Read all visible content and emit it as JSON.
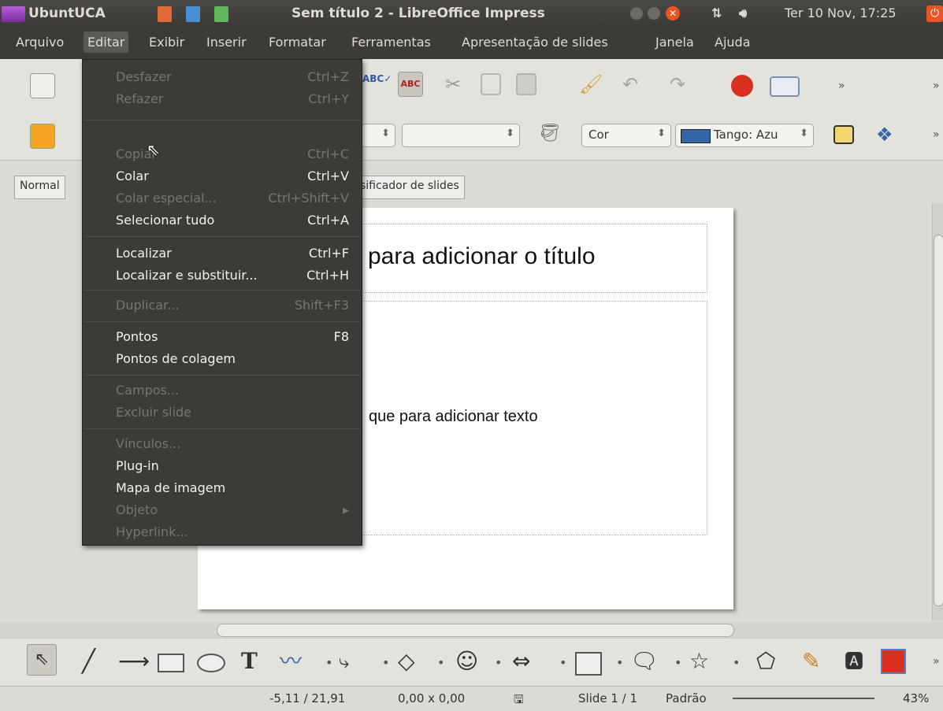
{
  "top_panel": {
    "app_name": "UbuntUCA",
    "window_title": "Sem título 2 - LibreOffice Impress",
    "datetime": "Ter 10 Nov, 17:25"
  },
  "menubar": [
    "Arquivo",
    "Editar",
    "Exibir",
    "Inserir",
    "Formatar",
    "Ferramentas",
    "Apresentação de slides",
    "Janela",
    "Ajuda"
  ],
  "toolbar2": {
    "fill_label": "Cor",
    "fill_color": "Tango: Azu"
  },
  "view_tabs": {
    "normal": "Normal",
    "sorter": "sificador de slides"
  },
  "slide": {
    "title_placeholder": "para adicionar o título",
    "text_placeholder": "que para adicionar texto"
  },
  "edit_menu": [
    {
      "label": "Desfazer",
      "shortcut": "Ctrl+Z",
      "enabled": false
    },
    {
      "label": "Refazer",
      "shortcut": "Ctrl+Y",
      "enabled": false
    },
    {
      "label": "Copiar",
      "shortcut": "Ctrl+C",
      "enabled": false
    },
    {
      "label": "Colar",
      "shortcut": "Ctrl+V",
      "enabled": true
    },
    {
      "label": "Colar especial...",
      "shortcut": "Ctrl+Shift+V",
      "enabled": false
    },
    {
      "label": "Selecionar tudo",
      "shortcut": "Ctrl+A",
      "enabled": true
    },
    {
      "label": "Localizar",
      "shortcut": "Ctrl+F",
      "enabled": true
    },
    {
      "label": "Localizar e substituir...",
      "shortcut": "Ctrl+H",
      "enabled": true
    },
    {
      "label": "Duplicar...",
      "shortcut": "Shift+F3",
      "enabled": false
    },
    {
      "label": "Pontos",
      "shortcut": "F8",
      "enabled": true
    },
    {
      "label": "Pontos de colagem",
      "shortcut": "",
      "enabled": true
    },
    {
      "label": "Campos...",
      "shortcut": "",
      "enabled": false
    },
    {
      "label": "Excluir slide",
      "shortcut": "",
      "enabled": false
    },
    {
      "label": "Vínculos...",
      "shortcut": "",
      "enabled": false
    },
    {
      "label": "Plug-in",
      "shortcut": "",
      "enabled": true
    },
    {
      "label": "Mapa de imagem",
      "shortcut": "",
      "enabled": true
    },
    {
      "label": "Objeto",
      "shortcut": "",
      "enabled": false
    },
    {
      "label": "Hyperlink...",
      "shortcut": "",
      "enabled": false
    }
  ],
  "status": {
    "position": "-5,11 / 21,91",
    "size": "0,00 x 0,00",
    "slide": "Slide 1 / 1",
    "layout": "Padrão",
    "zoom": "43%"
  },
  "colors": {
    "panel": "#3c3b37",
    "accent": "#e95420",
    "menu_bg": "#3c3b37"
  }
}
